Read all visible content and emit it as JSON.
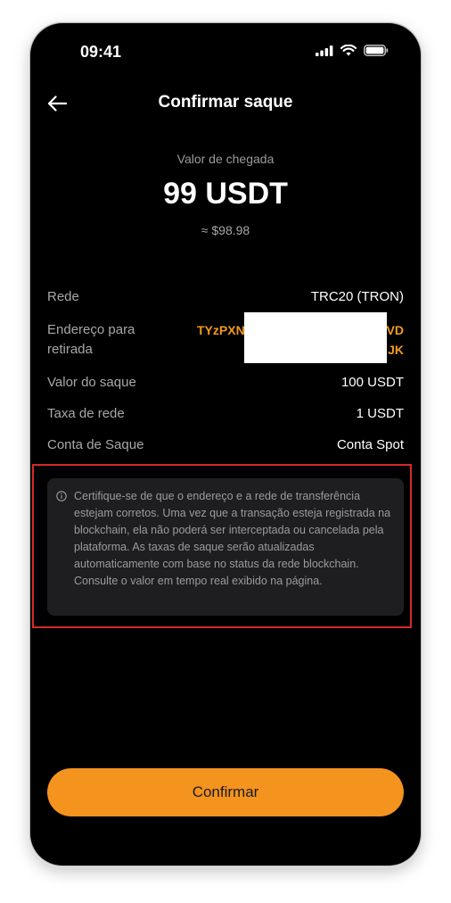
{
  "status_bar": {
    "time": "09:41",
    "icons": [
      "signal-icon",
      "wifi-icon",
      "battery-icon"
    ]
  },
  "header": {
    "title": "Confirmar saque",
    "back_icon": "arrow-left-icon"
  },
  "arrival": {
    "label": "Valor de chegada",
    "amount": "99 USDT",
    "fiat_value": "≈ $98.98"
  },
  "details": {
    "network": {
      "label": "Rede",
      "value": "TRC20 (TRON)"
    },
    "address": {
      "label": "Endereço para retirada",
      "value_visible_start": "TYzPXN",
      "value_line1_end": "VD",
      "value_line2_end": "JK"
    },
    "withdraw_amount": {
      "label": "Valor do saque",
      "value": "100 USDT"
    },
    "network_fee": {
      "label": "Taxa de rede",
      "value": "1 USDT"
    },
    "account": {
      "label": "Conta de Saque",
      "value": "Conta Spot"
    }
  },
  "notice": {
    "icon": "info-circle-icon",
    "text": "Certifique-se de que o endereço e a rede de transferência estejam corretos. Uma vez que a transação esteja registrada na blockchain, ela não poderá ser interceptada ou cancelada pela plataforma. As taxas de saque serão atualizadas automaticamente com base no status da rede blockchain. Consulte o valor em tempo real exibido na página."
  },
  "confirm_button": {
    "label": "Confirmar"
  },
  "colors": {
    "background": "#000000",
    "accent": "#f4931e",
    "address_text": "#f39a1c",
    "notice_bg": "#1e1e21",
    "highlight_border": "#d42a2a"
  }
}
